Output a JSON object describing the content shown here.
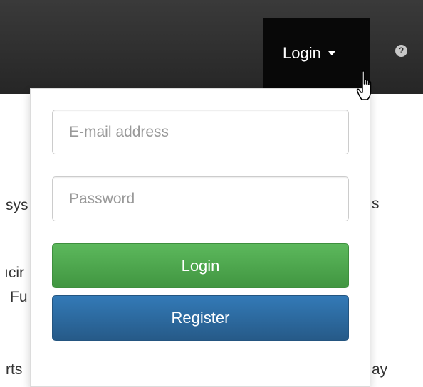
{
  "navbar": {
    "login_label": "Login",
    "help_glyph": "?"
  },
  "background_text": {
    "left_line1": "sys",
    "left_line2": "ıcir",
    "left_line3": "Fu",
    "left_line4": "rts",
    "right_line1": "s",
    "right_line2": "ay"
  },
  "login_form": {
    "email_placeholder": "E-mail address",
    "password_placeholder": "Password",
    "login_button": "Login",
    "register_button": "Register"
  },
  "colors": {
    "navbar": "#262626",
    "active_nav": "#080808",
    "login_button": "#5cb85c",
    "register_button": "#337ab7"
  },
  "icons": [
    "caret-down-icon",
    "help-icon",
    "hand-pointer-icon"
  ]
}
